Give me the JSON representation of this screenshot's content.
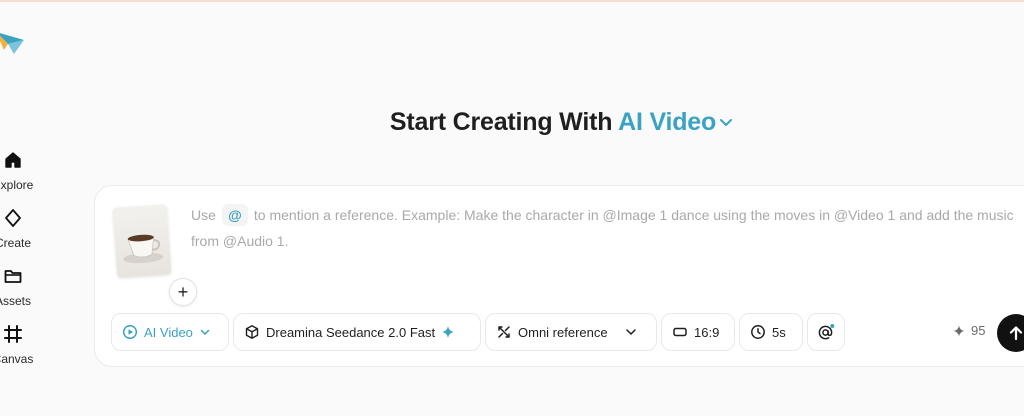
{
  "sidebar": {
    "items": [
      {
        "label": "Explore",
        "icon": "home-icon"
      },
      {
        "label": "Create",
        "icon": "diamond-icon"
      },
      {
        "label": "Assets",
        "icon": "folder-icon"
      },
      {
        "label": "Canvas",
        "icon": "frame-icon"
      }
    ]
  },
  "heading": {
    "prefix": "Start Creating With",
    "mode": "AI Video"
  },
  "composer": {
    "prompt_before": "Use",
    "mention_symbol": "@",
    "prompt_after": "to mention a reference. Example: Make the character in @Image 1 dance using the moves in @Video 1 and add the music from @Audio 1."
  },
  "toolbar": {
    "mode": "AI Video",
    "model": "Dreamina Seedance 2.0 Fast",
    "reference": "Omni reference",
    "ratio": "16:9",
    "duration": "5s",
    "credits": "95"
  },
  "colors": {
    "accent": "#3ba2c2",
    "send_button": "#111111"
  }
}
